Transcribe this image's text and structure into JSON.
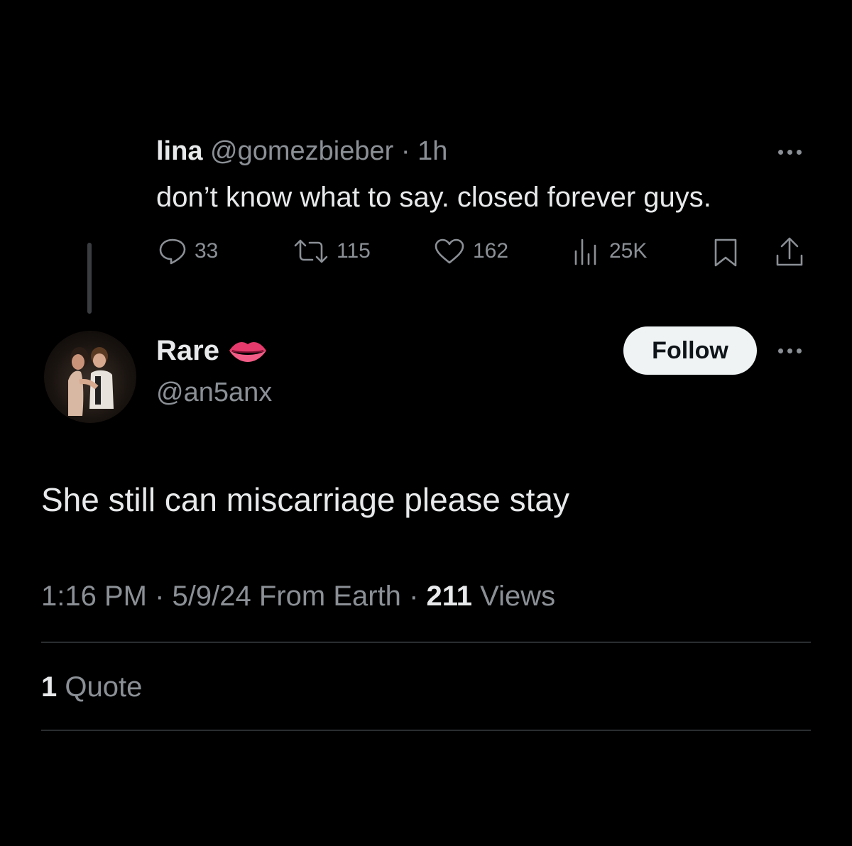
{
  "parent": {
    "name": "lina",
    "handle": "@gomezbieber",
    "sep": "·",
    "time": "1h",
    "text": "don’t know what to say. closed forever guys.",
    "replies": "33",
    "retweets": "115",
    "likes": "162",
    "views": "25K"
  },
  "post": {
    "name": "Rare",
    "emoji": "👄",
    "handle": "@an5anx",
    "follow_label": "Follow",
    "text": "She still can miscarriage please stay",
    "time": "1:16 PM",
    "sep": "·",
    "date": "5/9/24",
    "source": "From Earth",
    "views_count": "211",
    "views_label": "Views",
    "quote_count": "1",
    "quote_label": "Quote"
  },
  "icons": [
    "reply-icon",
    "retweet-icon",
    "like-icon",
    "views-icon",
    "bookmark-icon",
    "share-icon",
    "more-icon"
  ],
  "colors": {
    "background": "#000000",
    "text": "#e7e9ea",
    "muted": "#8b9096",
    "follow_bg": "#eff3f4",
    "follow_text": "#0f1419"
  }
}
